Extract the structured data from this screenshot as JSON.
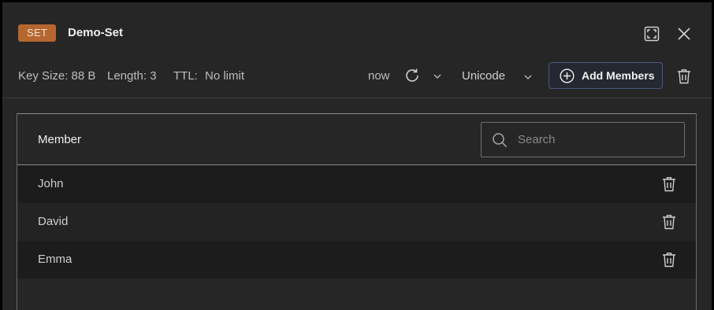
{
  "header": {
    "type_badge": "SET",
    "key_name": "Demo-Set",
    "key_size": "Key Size: 88 B",
    "length": "Length: 3",
    "ttl_label": "TTL:",
    "ttl_value": "No limit",
    "refresh_time": "now",
    "format": "Unicode",
    "add_members_label": "Add Members"
  },
  "table": {
    "column_title": "Member",
    "search_placeholder": "Search",
    "rows": [
      {
        "member": "John"
      },
      {
        "member": "David"
      },
      {
        "member": "Emma"
      }
    ]
  },
  "colors": {
    "badge": "#b5672f",
    "panel": "#262626",
    "button_border": "#4a5a7e"
  },
  "icons": [
    "expand-icon",
    "close-icon",
    "refresh-icon",
    "chevron-down-icon",
    "plus-circle-icon",
    "trash-icon",
    "search-icon"
  ]
}
